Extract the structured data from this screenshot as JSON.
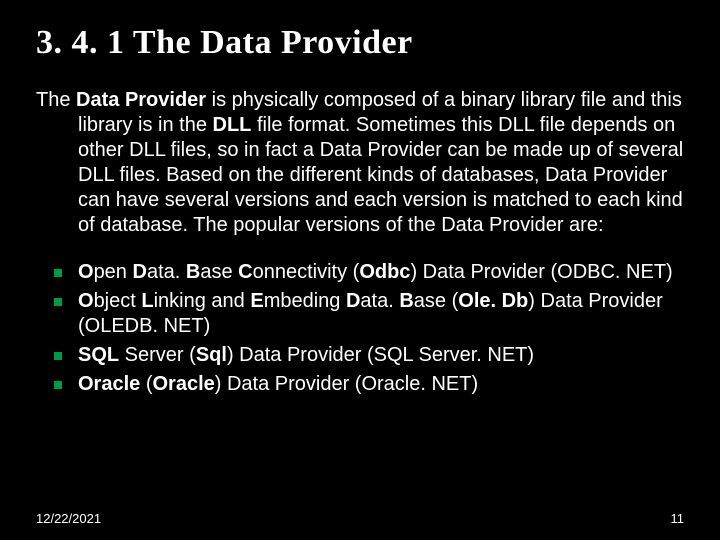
{
  "title": "3. 4. 1  The Data Provider",
  "paragraph": {
    "lead_pre": "The ",
    "lead_bold": "Data Provider",
    "lead_post": " is physically composed of a binary library file and this library is in the ",
    "dll": "DLL",
    "rest": " file format. Sometimes this DLL file depends on other DLL files, so in fact a Data Provider can be made up of several DLL files. Based on the different kinds of databases, Data Provider can have several versions and each version is matched to each kind of database. The popular versions of the Data Provider are:"
  },
  "items": [
    {
      "t1": "O",
      "t2": "pen ",
      "t3": "D",
      "t4": "ata. ",
      "t5": "B",
      "t6": "ase ",
      "t7": "C",
      "t8": "onnectivity (",
      "t9": "Odbc",
      "t10": ") Data Provider (ODBC. NET)"
    },
    {
      "t1": "O",
      "t2": "bject ",
      "t3": "L",
      "t4": "inking and ",
      "t5": "E",
      "t6": "mbeding ",
      "t7": "D",
      "t8": "ata. ",
      "extra1": "B",
      "extra2": "ase (",
      "t9": "Ole. Db",
      "t10": ") Data Provider (OLEDB. NET)"
    },
    {
      "t1": "SQL",
      "t2": " Server (",
      "t9": "Sql",
      "t10": ") Data Provider (SQL Server. NET)"
    },
    {
      "t1": "Oracle",
      "t2": " (",
      "t9": "Oracle",
      "t10": ") Data Provider (Oracle. NET)"
    }
  ],
  "footer": {
    "date": "12/22/2021",
    "page": "11"
  }
}
